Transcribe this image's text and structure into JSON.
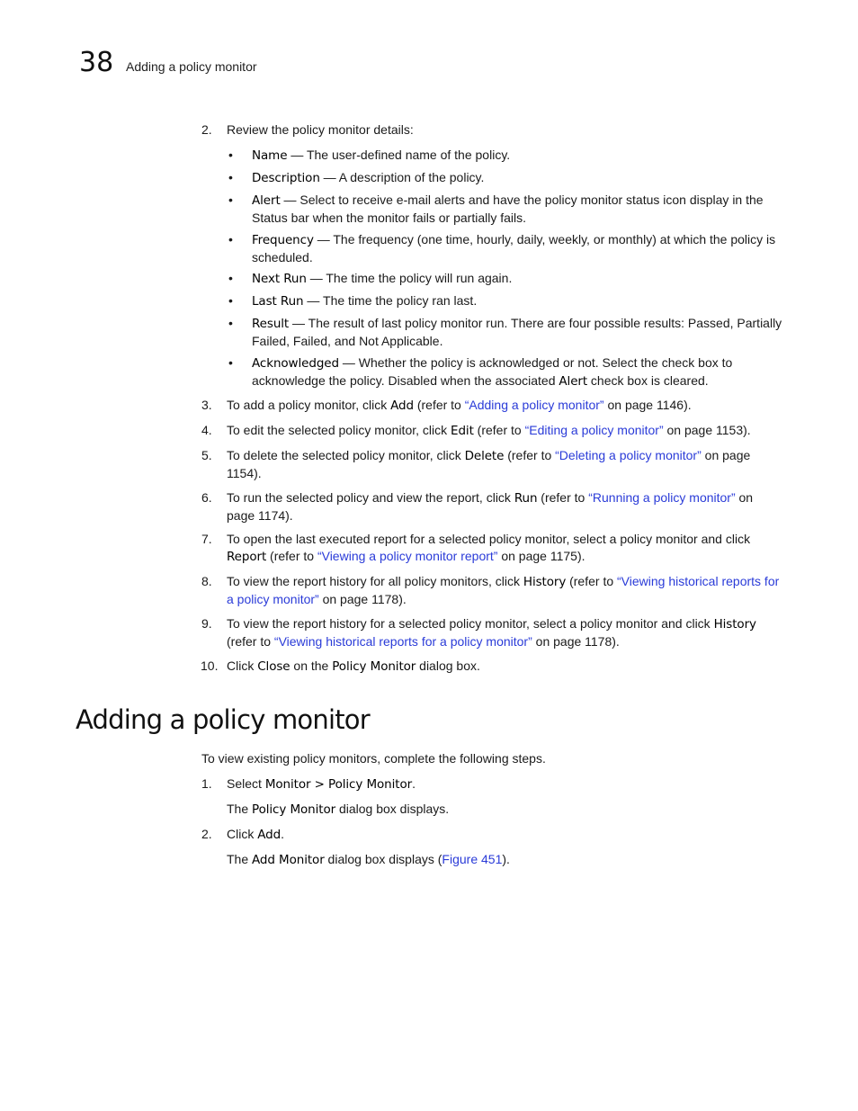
{
  "header": {
    "chapter_number": "38",
    "running_title": "Adding a policy monitor"
  },
  "review_steps": {
    "step2": {
      "number": "2.",
      "text": "Review the policy monitor details:",
      "bullets": [
        {
          "term": "Name",
          "text": " — The user-defined name of the policy."
        },
        {
          "term": "Description",
          "text": " — A description of the policy."
        },
        {
          "term": "Alert",
          "text": " — Select to receive e-mail alerts and have the policy monitor status icon display in the Status bar when the monitor fails or partially fails."
        },
        {
          "term": "Frequency",
          "text": " — The frequency (one time, hourly, daily, weekly, or monthly) at which the policy is scheduled."
        },
        {
          "term": "Next Run",
          "text": " — The time the policy will run again."
        },
        {
          "term": "Last Run",
          "text": " — The time the policy ran last."
        },
        {
          "term": "Result",
          "text": " — The result of last policy monitor run. There are four possible results: Passed, Partially Failed, Failed, and Not Applicable."
        },
        {
          "term": "Acknowledged",
          "text_a": " — Whether the policy is acknowledged or not. Select the check box to acknowledge the policy. Disabled when the associated ",
          "term2": "Alert",
          "text_b": " check box is cleared."
        }
      ]
    },
    "step3": {
      "number": "3.",
      "a": "To add a policy monitor, click ",
      "term": "Add",
      "b": " (refer to ",
      "link": "“Adding a policy monitor”",
      "c": " on page 1146)."
    },
    "step4": {
      "number": "4.",
      "a": "To edit the selected policy monitor, click ",
      "term": "Edit",
      "b": " (refer to ",
      "link": "“Editing a policy monitor”",
      "c": " on page 1153)."
    },
    "step5": {
      "number": "5.",
      "a": "To delete the selected policy monitor, click ",
      "term": "Delete",
      "b": " (refer to ",
      "link": "“Deleting a policy monitor”",
      "c": " on page 1154)."
    },
    "step6": {
      "number": "6.",
      "a": "To run the selected policy and view the report, click ",
      "term": "Run",
      "b": " (refer to ",
      "link": "“Running a policy monitor”",
      "c": " on page 1174)."
    },
    "step7": {
      "number": "7.",
      "a": "To open the last executed report for a selected policy monitor, select a policy monitor and click ",
      "term": "Report",
      "b": " (refer to ",
      "link": "“Viewing a policy monitor report”",
      "c": " on page 1175)."
    },
    "step8": {
      "number": "8.",
      "a": "To view the report history for all policy monitors, click ",
      "term": "History",
      "b": " (refer to ",
      "link": "“Viewing historical reports for a policy monitor”",
      "c": " on page 1178)."
    },
    "step9": {
      "number": "9.",
      "a": "To view the report history for a selected policy monitor, select a policy monitor and click ",
      "term": "History",
      "b": " (refer to ",
      "link": "“Viewing historical reports for a policy monitor”",
      "c": " on page 1178)."
    },
    "step10": {
      "number": "10.",
      "a": "Click ",
      "term": "Close",
      "b": " on the ",
      "term2": "Policy Monitor",
      "c": " dialog box."
    }
  },
  "section": {
    "title": "Adding a policy monitor",
    "intro": "To view existing policy monitors, complete the following steps.",
    "step1": {
      "number": "1.",
      "a": "Select ",
      "term": "Monitor > Policy Monitor",
      "b": "."
    },
    "step1_result": {
      "a": "The ",
      "term": "Policy Monitor",
      "b": " dialog box displays."
    },
    "step2": {
      "number": "2.",
      "a": "Click ",
      "term": "Add",
      "b": "."
    },
    "step2_result": {
      "a": "The ",
      "term": "Add Monitor",
      "b": " dialog box displays (",
      "link": "Figure 451",
      "c": ")."
    }
  }
}
